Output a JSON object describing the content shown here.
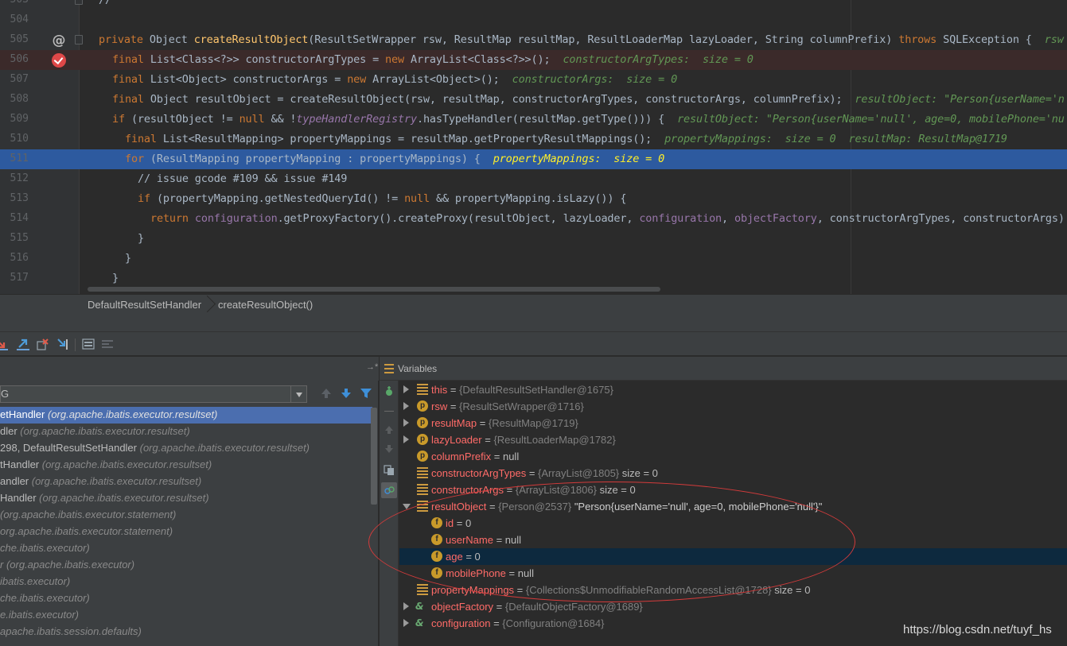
{
  "editor": {
    "lines": [
      {
        "num": "503",
        "text": "//"
      },
      {
        "num": "504",
        "text": ""
      },
      {
        "num": "505",
        "kw1": "private",
        "t1": " Object ",
        "fn": "createResultObject",
        "t2": "(ResultSetWrapper rsw, ResultMap resultMap, ResultLoaderMap lazyLoader, String columnPrefix) ",
        "kw2": "throws",
        "t3": " SQLException {  ",
        "hint": "rsw"
      },
      {
        "num": "506",
        "kw1": "final",
        "t1": " List<Class<?>> constructorArgTypes = ",
        "kw2": "new",
        "t2": " ArrayList<Class<?>>();  ",
        "hint": "constructorArgTypes:  size = 0"
      },
      {
        "num": "507",
        "kw1": "final",
        "t1": " List<Object> constructorArgs = ",
        "kw2": "new",
        "t2": " ArrayList<Object>();  ",
        "hint": "constructorArgs:  size = 0"
      },
      {
        "num": "508",
        "kw1": "final",
        "t1": " Object resultObject = createResultObject(rsw, resultMap, constructorArgTypes, constructorArgs, columnPrefix);  ",
        "hint": "resultObject: \"Person{userName='n"
      },
      {
        "num": "509",
        "kw1": "if",
        "t1": " (resultObject != ",
        "kw2": "null",
        "t2": " && !",
        "fld": "typeHandlerRegistry",
        "t3": ".hasTypeHandler(resultMap.getType())) {  ",
        "hint": "resultObject: \"Person{userName='null', age=0, mobilePhone='nu"
      },
      {
        "num": "510",
        "kw1": "final",
        "t1": " List<ResultMapping> propertyMappings = resultMap.getPropertyResultMappings();  ",
        "hint": "propertyMappings:  size = 0  resultMap: ResultMap@1719"
      },
      {
        "num": "511",
        "kw1": "for",
        "t1": " (ResultMapping propertyMapping : propertyMappings) {  ",
        "hint": "propertyMappings:  size = 0"
      },
      {
        "num": "512",
        "comment": "// issue gcode #109 && issue #149"
      },
      {
        "num": "513",
        "kw1": "if",
        "t1": " (propertyMapping.getNestedQueryId() != ",
        "kw2": "null",
        "t2": " && propertyMapping.isLazy()) {"
      },
      {
        "num": "514",
        "kw1": "return",
        "t1": " ",
        "fld": "configuration",
        "t2": ".getProxyFactory().createProxy(resultObject, lazyLoader, ",
        "fld2": "configuration",
        "t3": ", ",
        "fld3": "objectFactory",
        "t4": ", constructorArgTypes, constructorArgs)"
      },
      {
        "num": "515",
        "text": "}"
      },
      {
        "num": "516",
        "text": "}"
      },
      {
        "num": "517",
        "text": "}"
      }
    ]
  },
  "breadcrumb": {
    "class_name": "DefaultResultSetHandler",
    "method_name": "createResultObject()"
  },
  "debug": {
    "variables_title": "Variables",
    "thread_value": "G",
    "frames": [
      {
        "name": "etHandler ",
        "pkg": "(org.apache.ibatis.executor.resultset)"
      },
      {
        "name": "dler ",
        "pkg": "(org.apache.ibatis.executor.resultset)"
      },
      {
        "name": "298, DefaultResultSetHandler ",
        "pkg": "(org.apache.ibatis.executor.resultset)"
      },
      {
        "name": "tHandler ",
        "pkg": "(org.apache.ibatis.executor.resultset)"
      },
      {
        "name": "andler ",
        "pkg": "(org.apache.ibatis.executor.resultset)"
      },
      {
        "name": "Handler ",
        "pkg": "(org.apache.ibatis.executor.resultset)"
      },
      {
        "name": "",
        "pkg": "(org.apache.ibatis.executor.statement)"
      },
      {
        "name": "",
        "pkg": "org.apache.ibatis.executor.statement)"
      },
      {
        "name": "",
        "pkg": "che.ibatis.executor)"
      },
      {
        "name": "r ",
        "pkg": "(org.apache.ibatis.executor)"
      },
      {
        "name": "",
        "pkg": "ibatis.executor)"
      },
      {
        "name": "",
        "pkg": "che.ibatis.executor)"
      },
      {
        "name": "",
        "pkg": "e.ibatis.executor)"
      },
      {
        "name": "",
        "pkg": "apache.ibatis.session.defaults)"
      }
    ],
    "variables": [
      {
        "name": "this",
        "eq": " = ",
        "obj": "{DefaultResultSetHandler@1675}",
        "extra": "",
        "icon": "lines"
      },
      {
        "name": "rsw",
        "eq": " = ",
        "obj": "{ResultSetWrapper@1716}",
        "extra": "",
        "icon": "p"
      },
      {
        "name": "resultMap",
        "eq": " = ",
        "obj": "{ResultMap@1719}",
        "extra": "",
        "icon": "p"
      },
      {
        "name": "lazyLoader",
        "eq": " = ",
        "obj": "{ResultLoaderMap@1782}",
        "extra": "",
        "icon": "p"
      },
      {
        "name": "columnPrefix",
        "eq": " = ",
        "obj": "",
        "extra": "null",
        "icon": "p"
      },
      {
        "name": "constructorArgTypes",
        "eq": " = ",
        "obj": "{ArrayList@1805}",
        "extra": "  size = 0",
        "icon": "lines"
      },
      {
        "name": "constructorArgs",
        "eq": " = ",
        "obj": "{ArrayList@1806}",
        "extra": "  size = 0",
        "icon": "lines"
      },
      {
        "name": "resultObject",
        "eq": " = ",
        "obj": "{Person@2537}",
        "extra": " \"Person{userName='null', age=0, mobilePhone='null'}\"",
        "icon": "lines"
      },
      {
        "name": "id",
        "eq": " = ",
        "obj": "",
        "extra": "0",
        "icon": "f"
      },
      {
        "name": "userName",
        "eq": " = ",
        "obj": "",
        "extra": "null",
        "icon": "f"
      },
      {
        "name": "age",
        "eq": " = ",
        "obj": "",
        "extra": "0",
        "icon": "f"
      },
      {
        "name": "mobilePhone",
        "eq": " = ",
        "obj": "",
        "extra": "null",
        "icon": "f"
      },
      {
        "name": "propertyMappings",
        "eq": " = ",
        "obj": "{Collections$UnmodifiableRandomAccessList@1728}",
        "extra": "  size = 0",
        "icon": "lines"
      },
      {
        "name": "objectFactory",
        "eq": " = ",
        "obj": "{DefaultObjectFactory@1689}",
        "extra": "",
        "icon": "oo"
      },
      {
        "name": "configuration",
        "eq": " = ",
        "obj": "{Configuration@1684}",
        "extra": "",
        "icon": "oo"
      }
    ]
  },
  "watermark": "https://blog.csdn.net/tuyf_hs",
  "colors": {
    "accent_selection": "#4b6eaf",
    "current_line": "#2d5a9f",
    "annotation_circle": "#d33b3b"
  }
}
